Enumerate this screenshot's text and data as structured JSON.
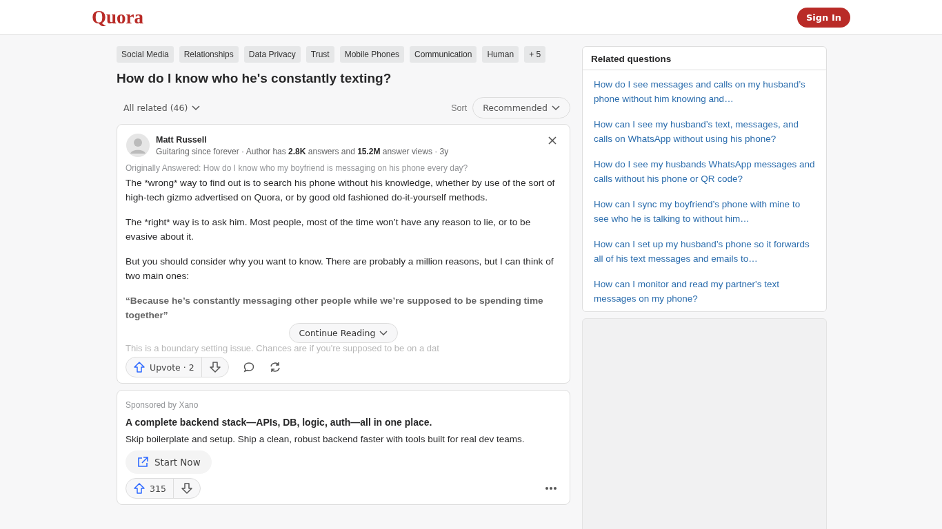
{
  "header": {
    "logo": "Quora",
    "sign_in": "Sign In"
  },
  "topics": [
    "Social Media",
    "Relationships",
    "Data Privacy",
    "Trust",
    "Mobile Phones",
    "Communication",
    "Human"
  ],
  "topics_more": "+ 5",
  "question": "How do I know who he's constantly texting?",
  "filter": {
    "all_related": "All related (46)",
    "sort_label": "Sort",
    "sort_value": "Recommended"
  },
  "answer": {
    "author": "Matt Russell",
    "credential": "Guitaring since forever · Author has **2.8K** answers and **15.2M** answer views · 3y",
    "originally": "Originally Answered: How do I know who my boyfriend is messaging on his phone every day?",
    "paragraphs": [
      {
        "kind": "text",
        "text": "The *wrong* way to find out is to search his phone without his knowledge, whether by use of the sort of high-tech gizmo advertised on Quora, or by good old fashioned do-it-yourself methods."
      },
      {
        "kind": "text",
        "text": "The *right* way is to ask him. Most people, most of the time won’t have any reason to lie, or to be evasive about it."
      },
      {
        "kind": "text",
        "text": "But you should consider why you want to know. There are probably a million reasons, but I can think of two main ones:"
      },
      {
        "kind": "quote",
        "text": "“Because he’s constantly messaging other people while we’re supposed to be spending time together”"
      },
      {
        "kind": "faded",
        "text": "This is a boundary setting issue. Chances are if you're supposed to be on a dat"
      }
    ],
    "continue": "Continue Reading",
    "upvote": "Upvote · 2"
  },
  "ad": {
    "sponsor": "Sponsored by Xano",
    "headline": "A complete backend stack—APIs, DB, logic, auth—all in one place.",
    "body": "Skip boilerplate and setup. Ship a clean, robust backend faster with tools built for real dev teams.",
    "cta": "Start Now",
    "upvotes": "315"
  },
  "related": {
    "title": "Related questions",
    "items": [
      "How do I see messages and calls on my husband’s phone without him knowing and…",
      "How can I see my husband’s text, messages, and calls on WhatsApp without using his phone?",
      "How do I see my husbands WhatsApp messages and calls without his phone or QR code?",
      "How can I sync my boyfriend’s phone with mine to see who he is talking to without him…",
      "How can I set up my husband’s phone so it forwards all of his text messages and emails to…",
      "How can I monitor and read my partner's text messages on my phone?"
    ]
  }
}
